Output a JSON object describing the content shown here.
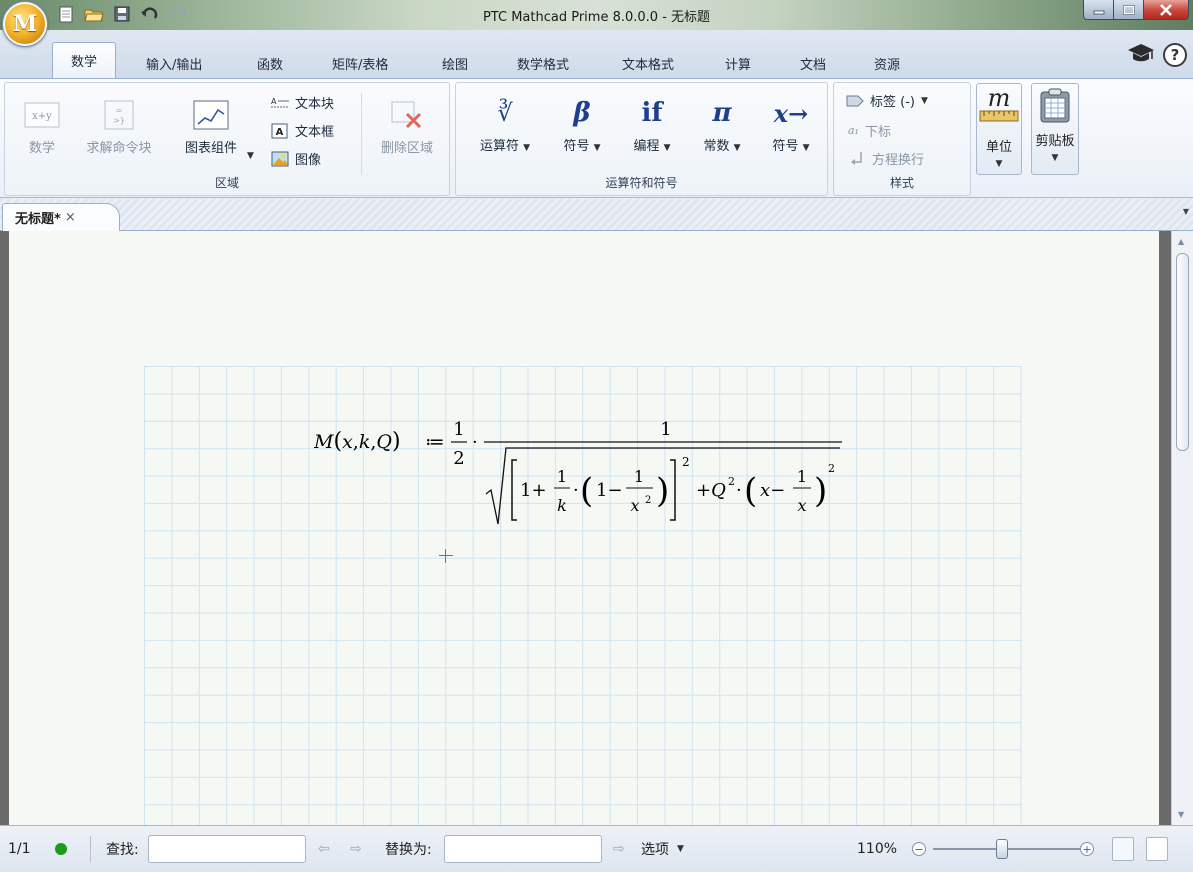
{
  "window": {
    "title": "PTC Mathcad Prime 8.0.0.0 - 无标题",
    "app_logo": "M",
    "controls": [
      "minimize-icon",
      "maximize-icon",
      "close-icon"
    ]
  },
  "quick_access": [
    "new-document-icon",
    "open-folder-icon",
    "save-icon",
    "undo-icon",
    "redo-icon"
  ],
  "ribbon_tabs": [
    "数学",
    "输入/输出",
    "函数",
    "矩阵/表格",
    "绘图",
    "数学格式",
    "文本格式",
    "计算",
    "文档",
    "资源"
  ],
  "active_tab": "数学",
  "help_icons": [
    "learning-cap-icon",
    "help-icon"
  ],
  "help_label": "?",
  "ribbon": {
    "region_group": {
      "label": "区域",
      "math_label": "数学",
      "math_icon_text": "x+y",
      "solve_block_label": "求解命令块",
      "chart_label": "图表组件",
      "text_block_label": "文本块",
      "text_box_label": "文本框",
      "image_label": "图像",
      "delete_region_label": "删除区域"
    },
    "operators_group": {
      "label": "运算符和符号",
      "operators": {
        "label": "运算符",
        "symbol": "∛"
      },
      "symbols": {
        "label": "符号",
        "symbol": "β"
      },
      "programming": {
        "label": "编程",
        "symbol": "if"
      },
      "constants": {
        "label": "常数",
        "symbol": "π"
      },
      "symbolics": {
        "label": "符号",
        "symbol": "x→"
      }
    },
    "style_group": {
      "label": "样式",
      "tag_label": "标签 (-)",
      "subscript_label": "下标",
      "subscript_prefix": "a₁",
      "line_break_label": "方程换行"
    },
    "units": {
      "label": "单位",
      "symbol": "m"
    },
    "clipboard": {
      "label": "剪贴板"
    }
  },
  "document_tab": {
    "name": "无标题*",
    "close": "×"
  },
  "math_region": {
    "lhs": "M(x,k,Q)",
    "assign_op": ":=",
    "coefficient": "1/2",
    "numerator": "1",
    "denominator": "√([1 + 1/k·(1 − 1/x²)]² + Q²·(x − 1/x)²)"
  },
  "statusbar": {
    "page": "1/1",
    "find_label": "查找:",
    "find_value": "",
    "replace_label": "替换为:",
    "replace_value": "",
    "options_label": "选项",
    "zoom": "110%",
    "zoom_level_fraction": 0.46,
    "status_color": "#1c9a1c"
  }
}
